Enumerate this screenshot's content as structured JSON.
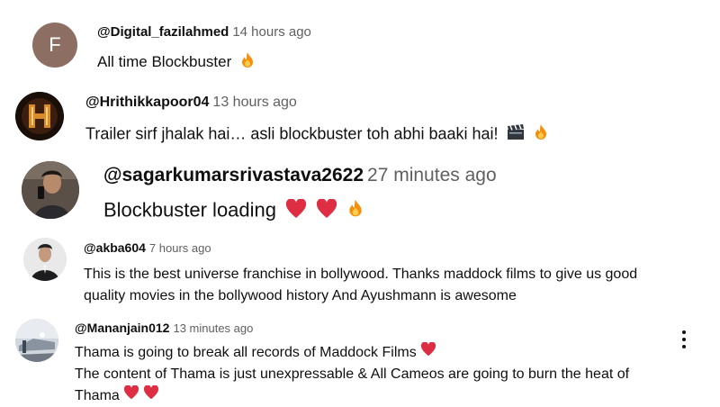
{
  "comments": [
    {
      "avatar": {
        "type": "letter",
        "letter": "F",
        "color": "#8d6e63"
      },
      "author": "@Digital_fazilahmed",
      "time": "14 hours ago",
      "lines": [
        "All time Blockbuster"
      ],
      "emojis": [
        "fire"
      ]
    },
    {
      "avatar": {
        "type": "image",
        "icon": "hk-logo-avatar"
      },
      "author": "@Hrithikkapoor04",
      "time": "13 hours ago",
      "lines": [
        "Trailer sirf jhalak hai… asli blockbuster toh abhi baaki hai!"
      ],
      "emojis": [
        "clapper-board",
        "fire"
      ]
    },
    {
      "avatar": {
        "type": "image",
        "icon": "selfie-photo-avatar"
      },
      "author": "@sagarkumarsrivastava2622",
      "time": "27 minutes ago",
      "lines": [
        "Blockbuster loading"
      ],
      "emojis": [
        "red-heart",
        "red-heart",
        "fire"
      ]
    },
    {
      "avatar": {
        "type": "image",
        "icon": "portrait-photo-avatar"
      },
      "author": "@akba604",
      "time": "7 hours ago",
      "lines": [
        "This is the best universe franchise in bollywood. Thanks maddock films to give us good",
        "quality movies in the bollywood history And  Ayushmann is awesome"
      ]
    },
    {
      "avatar": {
        "type": "image",
        "icon": "landscape-photo-avatar"
      },
      "author": "@Mananjain012",
      "time": "13 minutes ago",
      "lines": [
        "Thama is going to break all records of Maddock Films",
        "The content of Thama is just unexpressable & All Cameos are going to burn the heat of",
        "Thama"
      ],
      "line_emojis": [
        [
          "red-heart"
        ],
        [],
        [
          "red-heart",
          "red-heart"
        ]
      ]
    }
  ],
  "menu": {
    "icon": "more-vert-icon"
  },
  "colors": {
    "author": "#0f0f0f",
    "time": "#606060",
    "heart": "#dd2e44"
  }
}
